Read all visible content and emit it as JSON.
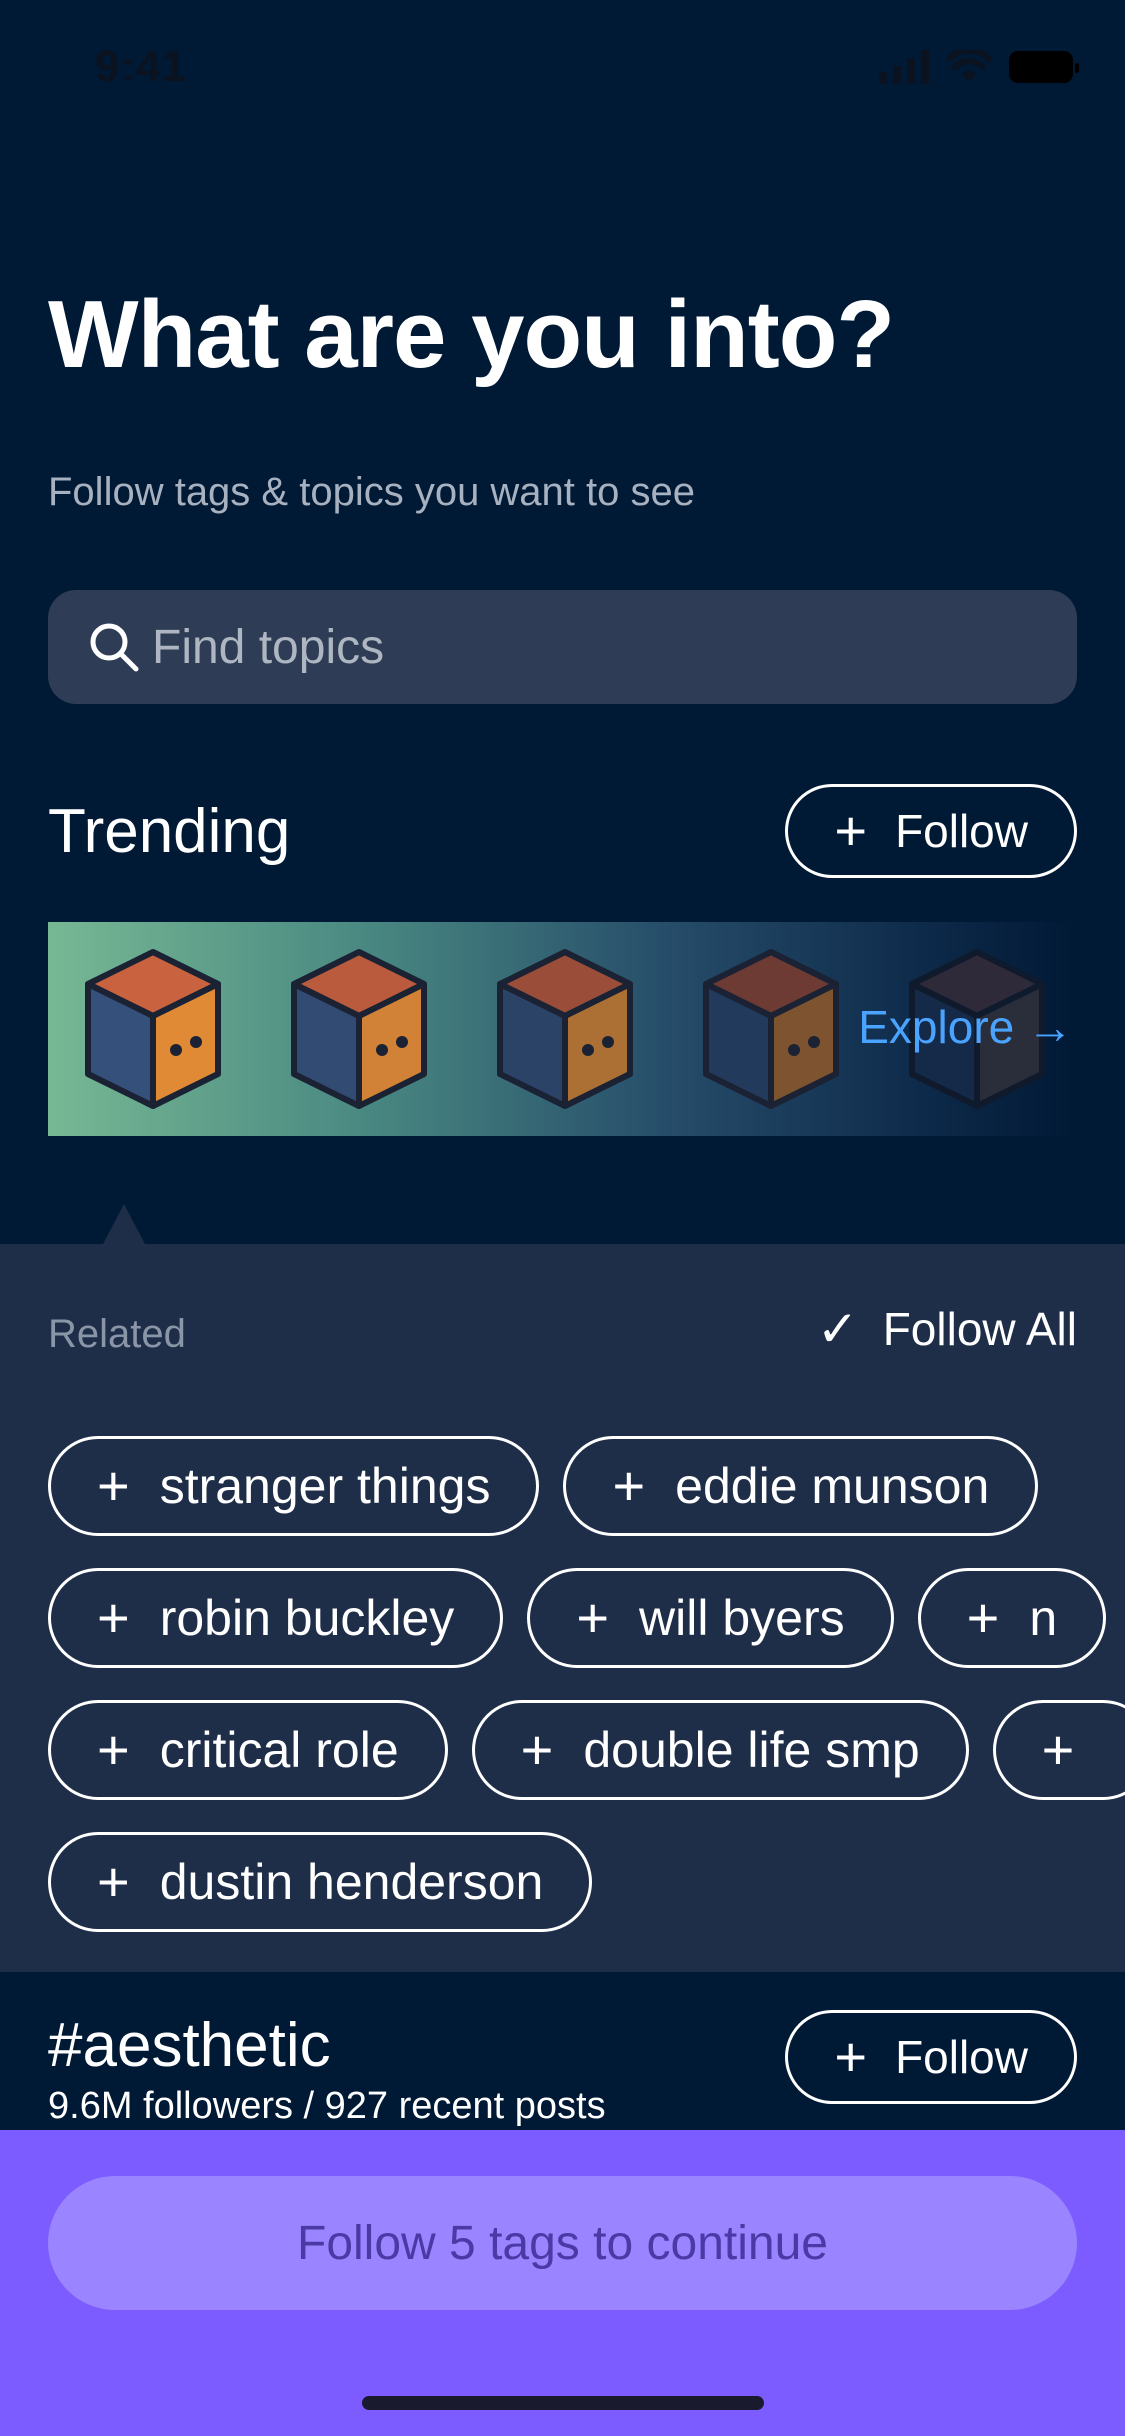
{
  "status_bar": {
    "time": "9:41"
  },
  "header": {
    "title": "What are you into?",
    "subtitle": "Follow tags & topics you want to see"
  },
  "search": {
    "placeholder": "Find topics"
  },
  "trending": {
    "title": "Trending",
    "follow_label": "Follow",
    "explore_label": "Explore →"
  },
  "related": {
    "label": "Related",
    "follow_all_label": "Follow All",
    "chips_row1": [
      "stranger things",
      "eddie munson"
    ],
    "chips_row2": [
      "robin buckley",
      "will byers",
      "n"
    ],
    "chips_row3": [
      "critical role",
      "double life smp",
      ""
    ],
    "chips_row4": [
      "dustin henderson"
    ]
  },
  "tag": {
    "name": "#aesthetic",
    "meta": "9.6M followers / 927 recent posts",
    "follow_label": "Follow"
  },
  "footer": {
    "continue_label": "Follow 5 tags to continue"
  },
  "colors": {
    "background": "#001935",
    "panel": "#1f2e48",
    "accent": "#7c5cff",
    "link": "#4aa3ff"
  }
}
